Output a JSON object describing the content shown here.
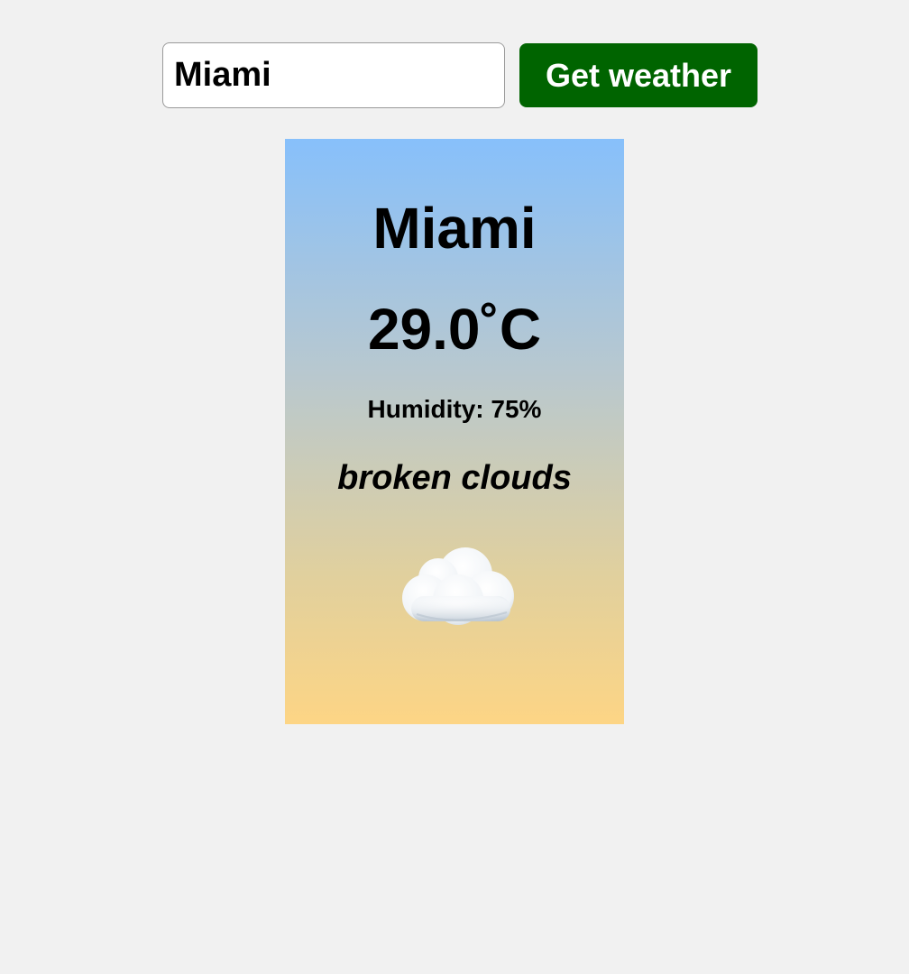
{
  "search": {
    "value": "Miami",
    "button_label": "Get weather"
  },
  "weather": {
    "city": "Miami",
    "temperature": "29.0˚C",
    "humidity": "Humidity: 75%",
    "description": "broken clouds",
    "icon": "cloud-icon"
  },
  "colors": {
    "page_background": "#f1f1f1",
    "button": "#006400",
    "button_text": "#ffffff",
    "card_gradient_top": "#87c0fb",
    "card_gradient_bottom": "#fdd585"
  }
}
